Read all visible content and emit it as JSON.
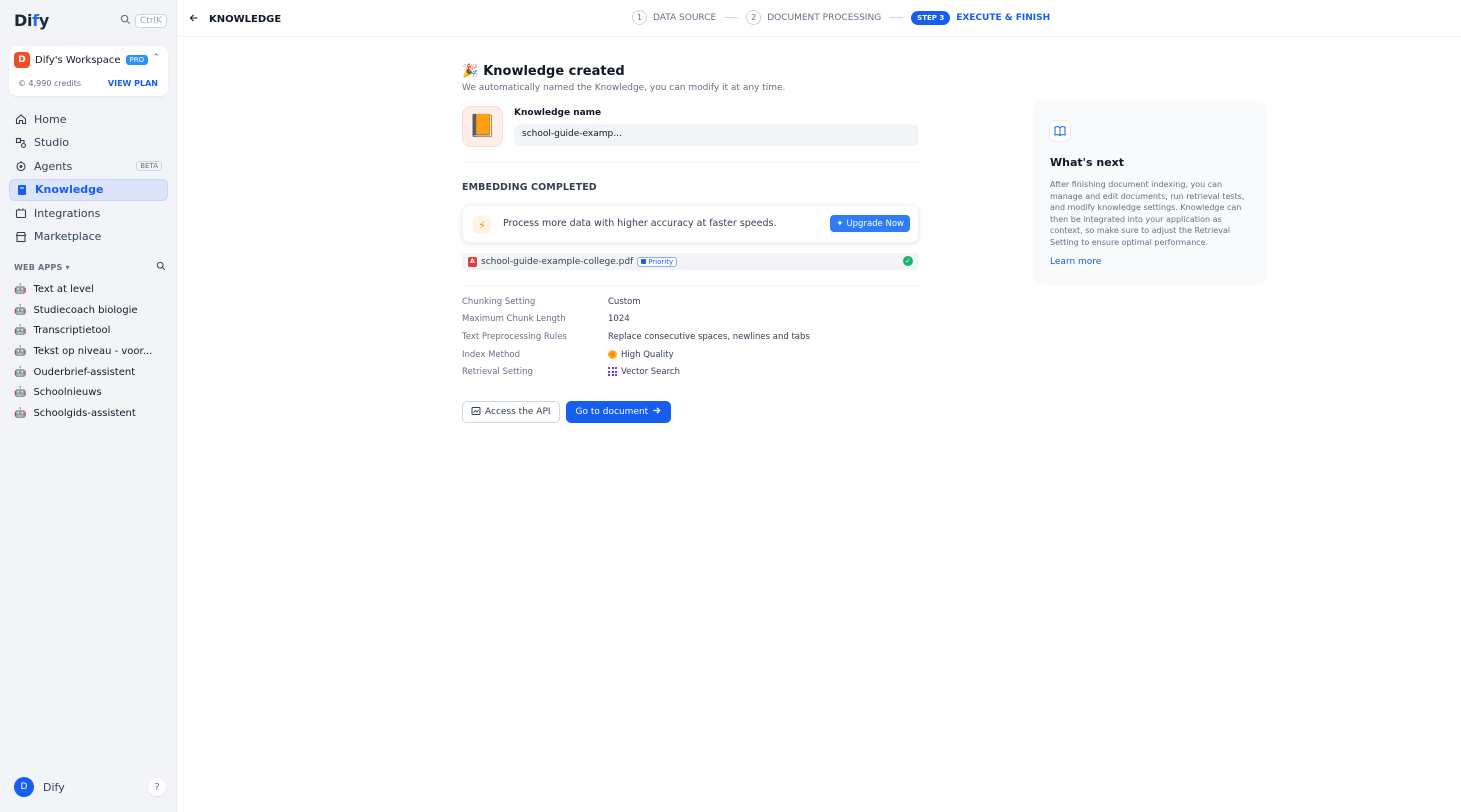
{
  "sidebar": {
    "logo": "Dify",
    "search_shortcut": "CtrlK",
    "workspace": {
      "initial": "D",
      "name": "Dify's Workspace",
      "plan_badge": "PRO",
      "credits": "4,990 credits",
      "view_plan": "VIEW PLAN"
    },
    "nav": [
      {
        "label": "Home",
        "icon": "home-icon"
      },
      {
        "label": "Studio",
        "icon": "studio-icon"
      },
      {
        "label": "Agents",
        "icon": "agents-icon",
        "badge": "BETA"
      },
      {
        "label": "Knowledge",
        "icon": "knowledge-icon",
        "active": true
      },
      {
        "label": "Integrations",
        "icon": "integrations-icon"
      },
      {
        "label": "Marketplace",
        "icon": "marketplace-icon"
      }
    ],
    "web_apps_title": "WEB APPS",
    "web_apps": [
      "Text at level",
      "Studiecoach biologie",
      "Transcriptietool",
      "Tekst op niveau - voor...",
      "Ouderbrief-assistent",
      "Schoolnieuws",
      "Schoolgids-assistent"
    ],
    "user": {
      "initial": "D",
      "name": "Dify"
    },
    "help": "?"
  },
  "topbar": {
    "back_label": "KNOWLEDGE",
    "steps": [
      {
        "num": "1",
        "label": "DATA SOURCE"
      },
      {
        "num": "2",
        "label": "DOCUMENT PROCESSING"
      },
      {
        "pill": "STEP 3",
        "label": "EXECUTE & FINISH"
      }
    ]
  },
  "main": {
    "title_emoji": "🎉",
    "title": "Knowledge created",
    "subtitle": "We automatically named the Knowledge, you can modify it at any time.",
    "knowledge_name_label": "Knowledge name",
    "knowledge_name_value": "school-guide-examp...",
    "embedding_title": "EMBEDDING COMPLETED",
    "upgrade_text": "Process more data with higher accuracy at faster speeds.",
    "upgrade_button": "Upgrade Now",
    "file_name": "school-guide-example-college.pdf",
    "file_badge": "Priority",
    "settings": [
      {
        "key": "Chunking Setting",
        "value": "Custom"
      },
      {
        "key": "Maximum Chunk Length",
        "value": "1024"
      },
      {
        "key": "Text Preprocessing Rules",
        "value": "Replace consecutive spaces, newlines and tabs"
      },
      {
        "key": "Index Method",
        "value": "High Quality",
        "icon": "high-quality-icon"
      },
      {
        "key": "Retrieval Setting",
        "value": "Vector Search",
        "icon": "vector-search-icon"
      }
    ],
    "access_api": "Access the API",
    "go_to_document": "Go to document"
  },
  "next_panel": {
    "title": "What's next",
    "body": "After finishing document indexing, you can manage and edit documents, run retrieval tests, and modify knowledge settings. Knowledge can then be integrated into your application as context, so make sure to adjust the Retrieval Setting to ensure optimal performance.",
    "link": "Learn more"
  },
  "colors": {
    "accent": "#155eef",
    "sidebar_bg": "#f2f4f7",
    "success": "#17b26a"
  }
}
